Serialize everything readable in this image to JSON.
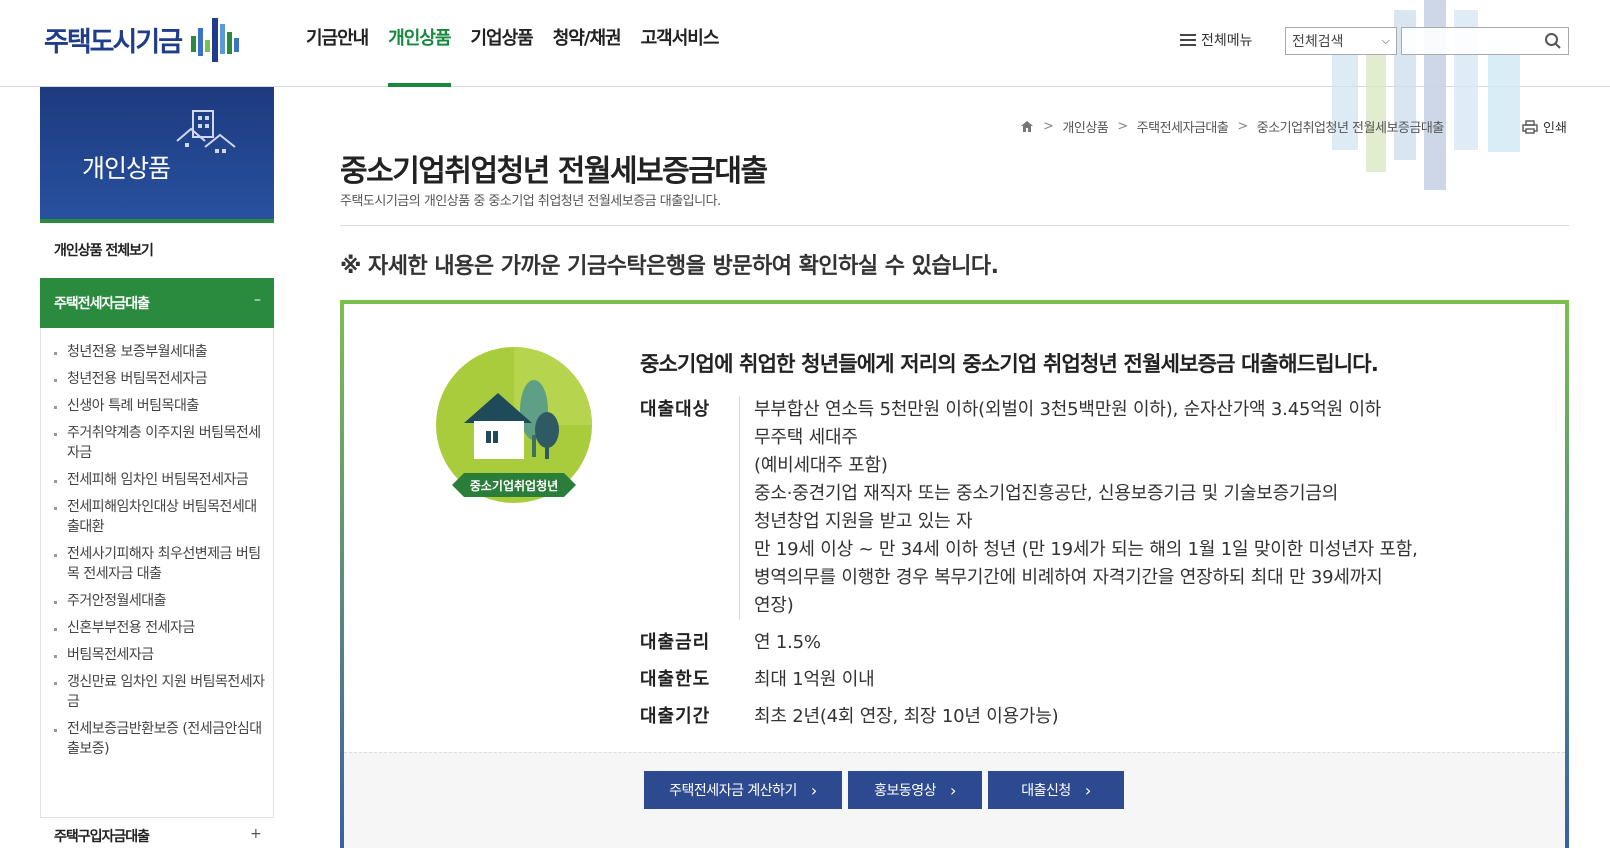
{
  "header": {
    "logo_text": "주택도시기금",
    "gnb": [
      "기금안내",
      "개인상품",
      "기업상품",
      "청약/채권",
      "고객서비스"
    ],
    "active_gnb": "개인상품",
    "all_menu": "전체메뉴",
    "search_select": "전체검색",
    "search_placeholder": ""
  },
  "sidebar": {
    "title": "개인상품",
    "all": "개인상품 전체보기",
    "section": "주택전세자금대출",
    "section_toggle": "–",
    "items": [
      "청년전용 보증부월세대출",
      "청년전용 버팀목전세자금",
      "신생아 특례 버팀목대출",
      "주거취약계층 이주지원 버팀목전세자금",
      "전세피해 임차인 버팀목전세자금",
      "전세피해임차인대상 버팀목전세대출대환",
      "전세사기피해자 최우선변제금 버팀목 전세자금 대출",
      "주거안정월세대출",
      "신혼부부전용 전세자금",
      "버팀목전세자금",
      "갱신만료 임차인 지원 버팀목전세자금",
      "전세보증금반환보증 (전세금안심대출보증)"
    ],
    "next_section": "주택구입자금대출",
    "next_toggle": "+"
  },
  "breadcrumb": [
    "개인상품",
    "주택전세자금대출",
    "중소기업취업청년 전월세보증금대출"
  ],
  "print_label": "인쇄",
  "page": {
    "title": "중소기업취업청년 전월세보증금대출",
    "desc": "주택도시기금의 개인상품 중 중소기업 취업청년 전월세보증금 대출입니다.",
    "notice": "※ 자세한 내용은 가까운 기금수탁은행을 방문하여 확인하실 수 있습니다."
  },
  "product": {
    "badge_label": "중소기업취업청년",
    "lead": "중소기업에 취업한 청년들에게 저리의 중소기업 취업청년 전월세보증금 대출해드립니다.",
    "target_label": "대출대상",
    "target_lines": [
      "부부합산 연소득 5천만원 이하(외벌이 3천5백만원 이하), 순자산가액 3.45억원 이하",
      "무주택 세대주",
      "(예비세대주 포함)",
      "중소·중견기업 재직자 또는 중소기업진흥공단, 신용보증기금 및 기술보증기금의",
      "청년창업 지원을 받고 있는 자",
      "만 19세 이상 ~ 만 34세 이하 청년 (만 19세가 되는 해의 1월 1일 맞이한 미성년자 포함,",
      "병역의무를 이행한 경우 복무기간에 비례하여 자격기간을 연장하되 최대 만 39세까지",
      "연장)"
    ],
    "rate_label": "대출금리",
    "rate": "연 1.5%",
    "limit_label": "대출한도",
    "limit": "최대 1억원 이내",
    "period_label": "대출기간",
    "period": "최초 2년(4회 연장, 최장 10년 이용가능)"
  },
  "buttons": [
    "주택전세자금 계산하기",
    "홍보동영상",
    "대출신청"
  ],
  "colors": {
    "navy": "#2d4a91",
    "green": "#2a8a3d"
  }
}
